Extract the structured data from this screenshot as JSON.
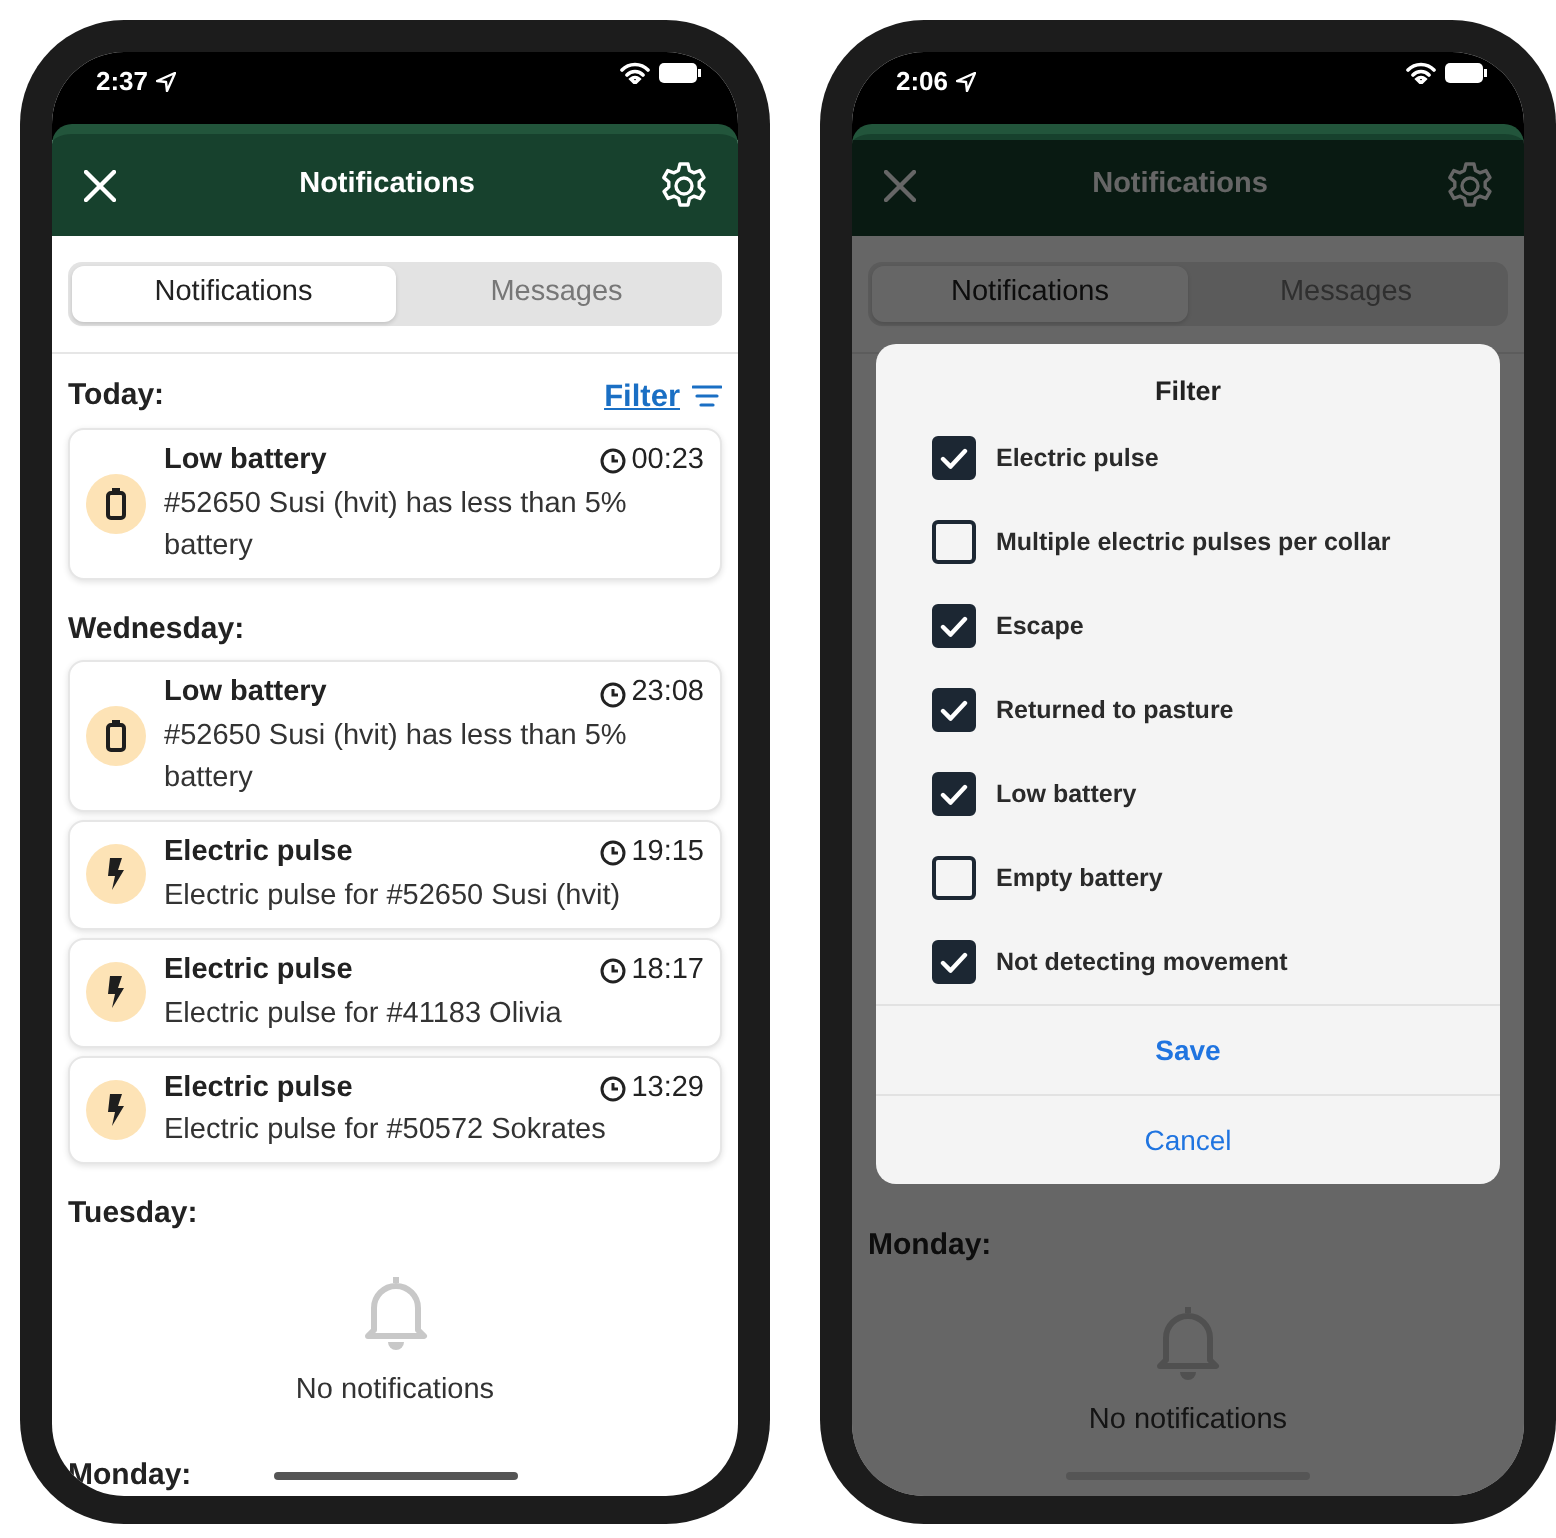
{
  "phones": [
    {
      "status_bar": {
        "time": "2:37"
      },
      "header": {
        "title": "Notifications"
      },
      "dimmed": false,
      "tabs": [
        {
          "label": "Notifications",
          "selected": true
        },
        {
          "label": "Messages",
          "selected": false
        }
      ],
      "sections": [
        {
          "heading": "Today:",
          "filter_link": "Filter",
          "items": [
            {
              "kind": "battery",
              "title": "Low battery",
              "time": "00:23",
              "text": "#52650 Susi (hvit) has less than 5% battery"
            }
          ]
        },
        {
          "heading": "Wednesday:",
          "items": [
            {
              "kind": "battery",
              "title": "Low battery",
              "time": "23:08",
              "text": "#52650 Susi (hvit) has less than 5% battery"
            },
            {
              "kind": "pulse",
              "title": "Electric pulse",
              "time": "19:15",
              "text": "Electric pulse for #52650 Susi (hvit)"
            },
            {
              "kind": "pulse",
              "title": "Electric pulse",
              "time": "18:17",
              "text": "Electric pulse for #41183 Olivia"
            },
            {
              "kind": "pulse",
              "title": "Electric pulse",
              "time": "13:29",
              "text": "Electric pulse for #50572 Sokrates"
            }
          ]
        },
        {
          "heading": "Tuesday:",
          "empty_text": "No notifications"
        },
        {
          "heading": "Monday:"
        }
      ]
    },
    {
      "status_bar": {
        "time": "2:06"
      },
      "header": {
        "title": "Notifications"
      },
      "dimmed": true,
      "tabs": [
        {
          "label": "Notifications",
          "selected": true
        },
        {
          "label": "Messages",
          "selected": false
        }
      ],
      "sections": [
        {
          "heading": "Monday:",
          "empty_text": "No notifications"
        }
      ],
      "filter_dialog": {
        "title": "Filter",
        "options": [
          {
            "label": "Electric pulse",
            "checked": true
          },
          {
            "label": "Multiple electric pulses per collar",
            "checked": false
          },
          {
            "label": "Escape",
            "checked": true
          },
          {
            "label": "Returned to pasture",
            "checked": true
          },
          {
            "label": "Low battery",
            "checked": true
          },
          {
            "label": "Empty battery",
            "checked": false
          },
          {
            "label": "Not detecting movement",
            "checked": true
          }
        ],
        "buttons": [
          {
            "label": "Save",
            "kind": "primary"
          },
          {
            "label": "Cancel",
            "kind": "secondary"
          }
        ]
      }
    }
  ]
}
